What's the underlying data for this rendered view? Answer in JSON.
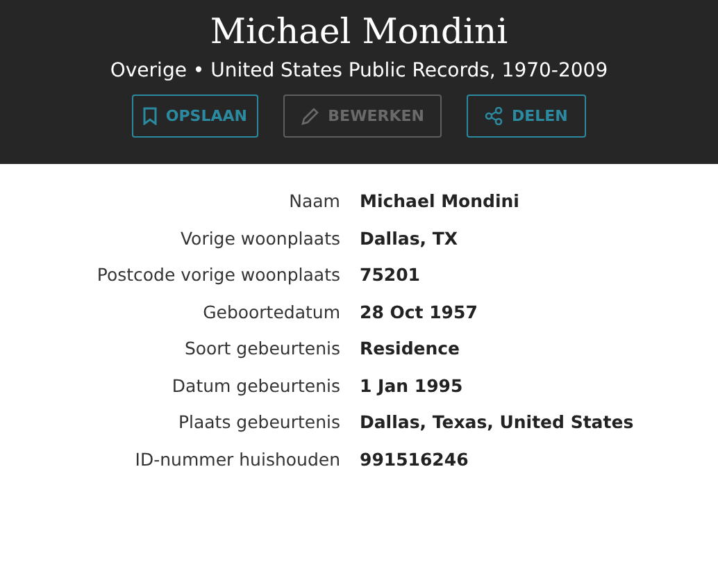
{
  "header": {
    "title": "Michael Mondini",
    "subtitle": "Overige • United States Public Records, 1970-2009"
  },
  "buttons": [
    {
      "label": "OPSLAAN",
      "kind": "bookmark",
      "disabled": false
    },
    {
      "label": "BEWERKEN",
      "kind": "pencil",
      "disabled": true
    },
    {
      "label": "DELEN",
      "kind": "share",
      "disabled": false
    }
  ],
  "fields": [
    {
      "label": "Naam",
      "value": "Michael Mondini"
    },
    {
      "label": "Vorige woonplaats",
      "value": "Dallas, TX"
    },
    {
      "label": "Postcode vorige woonplaats",
      "value": "75201"
    },
    {
      "label": "Geboortedatum",
      "value": "28 Oct 1957"
    },
    {
      "label": "Soort gebeurtenis",
      "value": "Residence"
    },
    {
      "label": "Datum gebeurtenis",
      "value": "1 Jan 1995"
    },
    {
      "label": "Plaats gebeurtenis",
      "value": "Dallas, Texas, United States"
    },
    {
      "label": "ID-nummer huishouden",
      "value": "991516246"
    }
  ]
}
